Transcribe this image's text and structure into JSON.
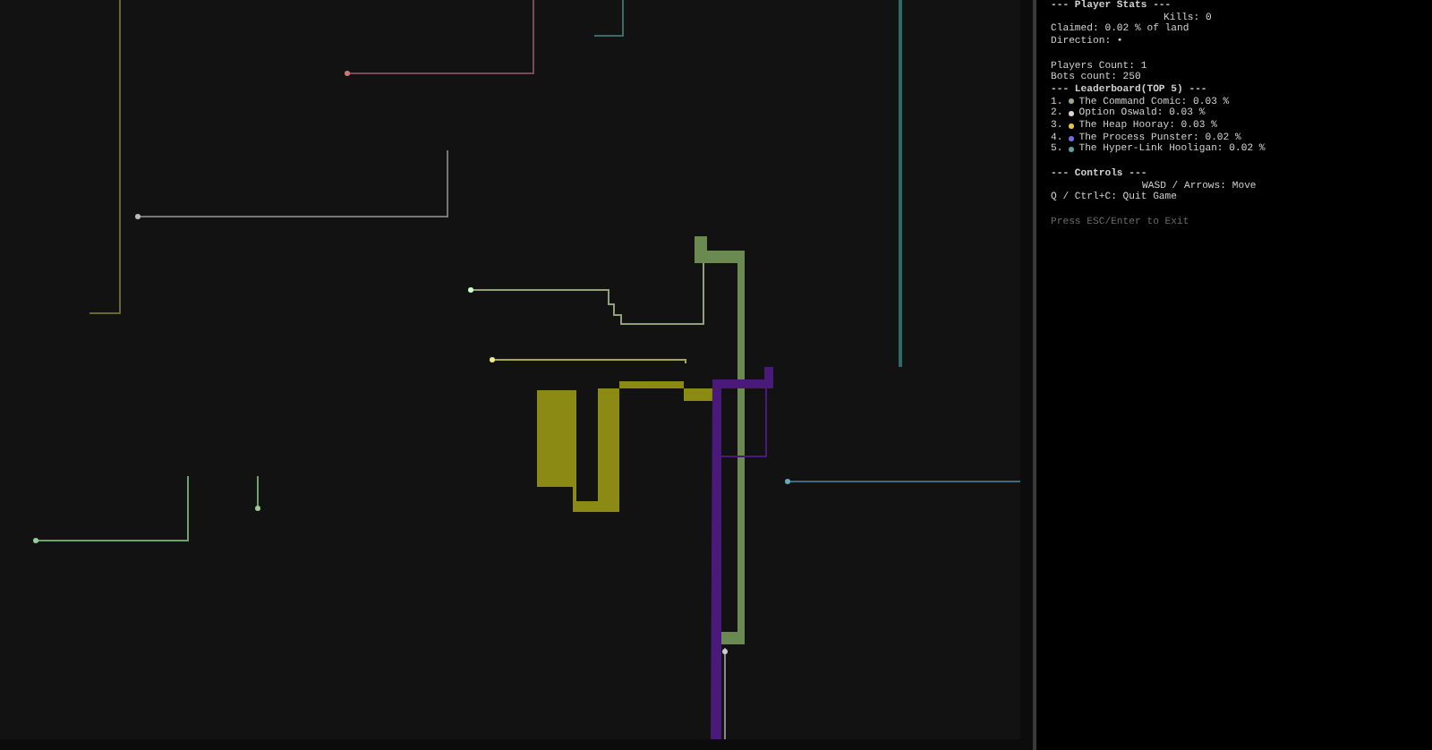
{
  "stats": {
    "title": "--- Player Stats ---",
    "kills": "Kills: 0",
    "claimed": "Claimed: 0.02 % of land",
    "direction": "Direction: •",
    "players": "Players Count: 1",
    "bots": "Bots count: 250"
  },
  "leaderboard": {
    "title": "--- Leaderboard(TOP 5) ---",
    "entries": [
      {
        "rank": "1.",
        "name": "The Command Comic: 0.03 %",
        "color": "#9aa58a"
      },
      {
        "rank": "2.",
        "name": "Option Oswald: 0.03 %",
        "color": "#d8d8d8"
      },
      {
        "rank": "3.",
        "name": "The Heap Hooray: 0.03 %",
        "color": "#e8c547"
      },
      {
        "rank": "4.",
        "name": "The Process Punster: 0.02 %",
        "color": "#6f6fe0"
      },
      {
        "rank": "5.",
        "name": "The Hyper-Link Hooligan: 0.02 %",
        "color": "#5f9ea0"
      }
    ]
  },
  "controls": {
    "title": "--- Controls ---",
    "move": "WASD / Arrows: Move",
    "quit": "Q / Ctrl+C: Quit Game"
  },
  "hint": "Press ESC/Enter to Exit"
}
